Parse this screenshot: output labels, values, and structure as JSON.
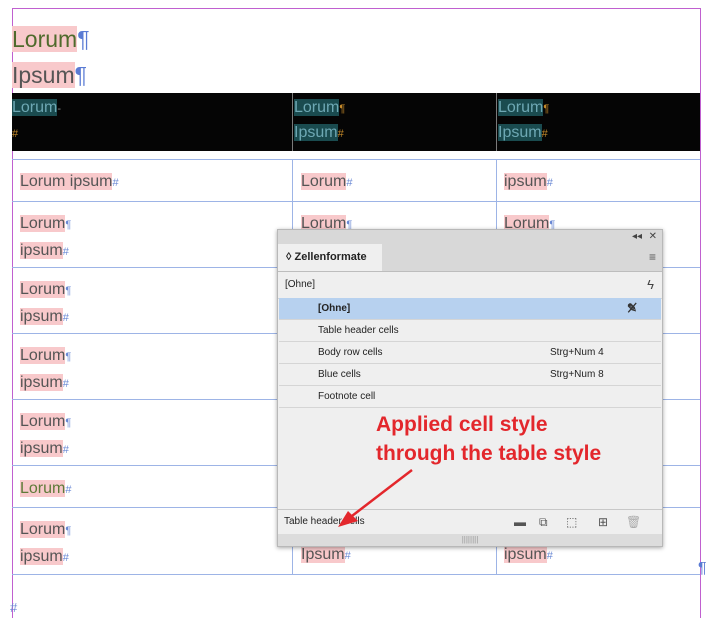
{
  "document": {
    "title_lines": [
      "Lorum",
      "Ipsum"
    ],
    "pilcrow": "¶",
    "hash": "#",
    "header_row": [
      {
        "lines": [
          "Lorum"
        ]
      },
      {
        "lines": [
          "Lorum",
          "Ipsum"
        ]
      },
      {
        "lines": [
          "Lorum",
          "Ipsum"
        ]
      }
    ],
    "body_rows": [
      {
        "col1": [
          "Lorum ipsum"
        ],
        "col2": [
          "Lorum"
        ],
        "col3": [
          "ipsum"
        ]
      },
      {
        "col1": [
          "Lorum",
          "ipsum"
        ],
        "col2": [
          "Lorum"
        ],
        "col3": [
          "Lorum"
        ]
      },
      {
        "col1": [
          "Lorum",
          "ipsum"
        ]
      },
      {
        "col1": [
          "Lorum",
          "ipsum"
        ]
      },
      {
        "col1": [
          "Lorum",
          "ipsum"
        ]
      },
      {
        "col1": [
          "Lorum"
        ]
      },
      {
        "col1": [
          "Lorum",
          "ipsum"
        ],
        "col2": [
          "Ipsum"
        ],
        "col3": [
          "ipsum"
        ]
      }
    ]
  },
  "panel": {
    "collapse_glyph": "◂◂",
    "close_glyph": "✕",
    "tab_label": "◊ Zellenformate",
    "menu_icon": "≡",
    "current_style": "[Ohne]",
    "lightning_icon": "ϟ",
    "styles": [
      {
        "label": "[Ohne]",
        "shortcut": "",
        "selected": true
      },
      {
        "label": "Table header cells",
        "shortcut": "",
        "selected": false
      },
      {
        "label": "Body row cells",
        "shortcut": "Strg+Num 4",
        "selected": false
      },
      {
        "label": "Blue cells",
        "shortcut": "Strg+Num 8",
        "selected": false
      },
      {
        "label": "Footnote cell",
        "shortcut": "",
        "selected": false
      }
    ],
    "footer_label": "Table header cells",
    "footer_buttons": [
      "folder-icon",
      "clear-overrides-icon",
      "break-link-icon",
      "new-style-icon",
      "delete-icon"
    ],
    "grip": "||||||||"
  },
  "annotation": {
    "line1": "Applied cell style",
    "line2": "through the table style",
    "color": "#e3272c"
  }
}
